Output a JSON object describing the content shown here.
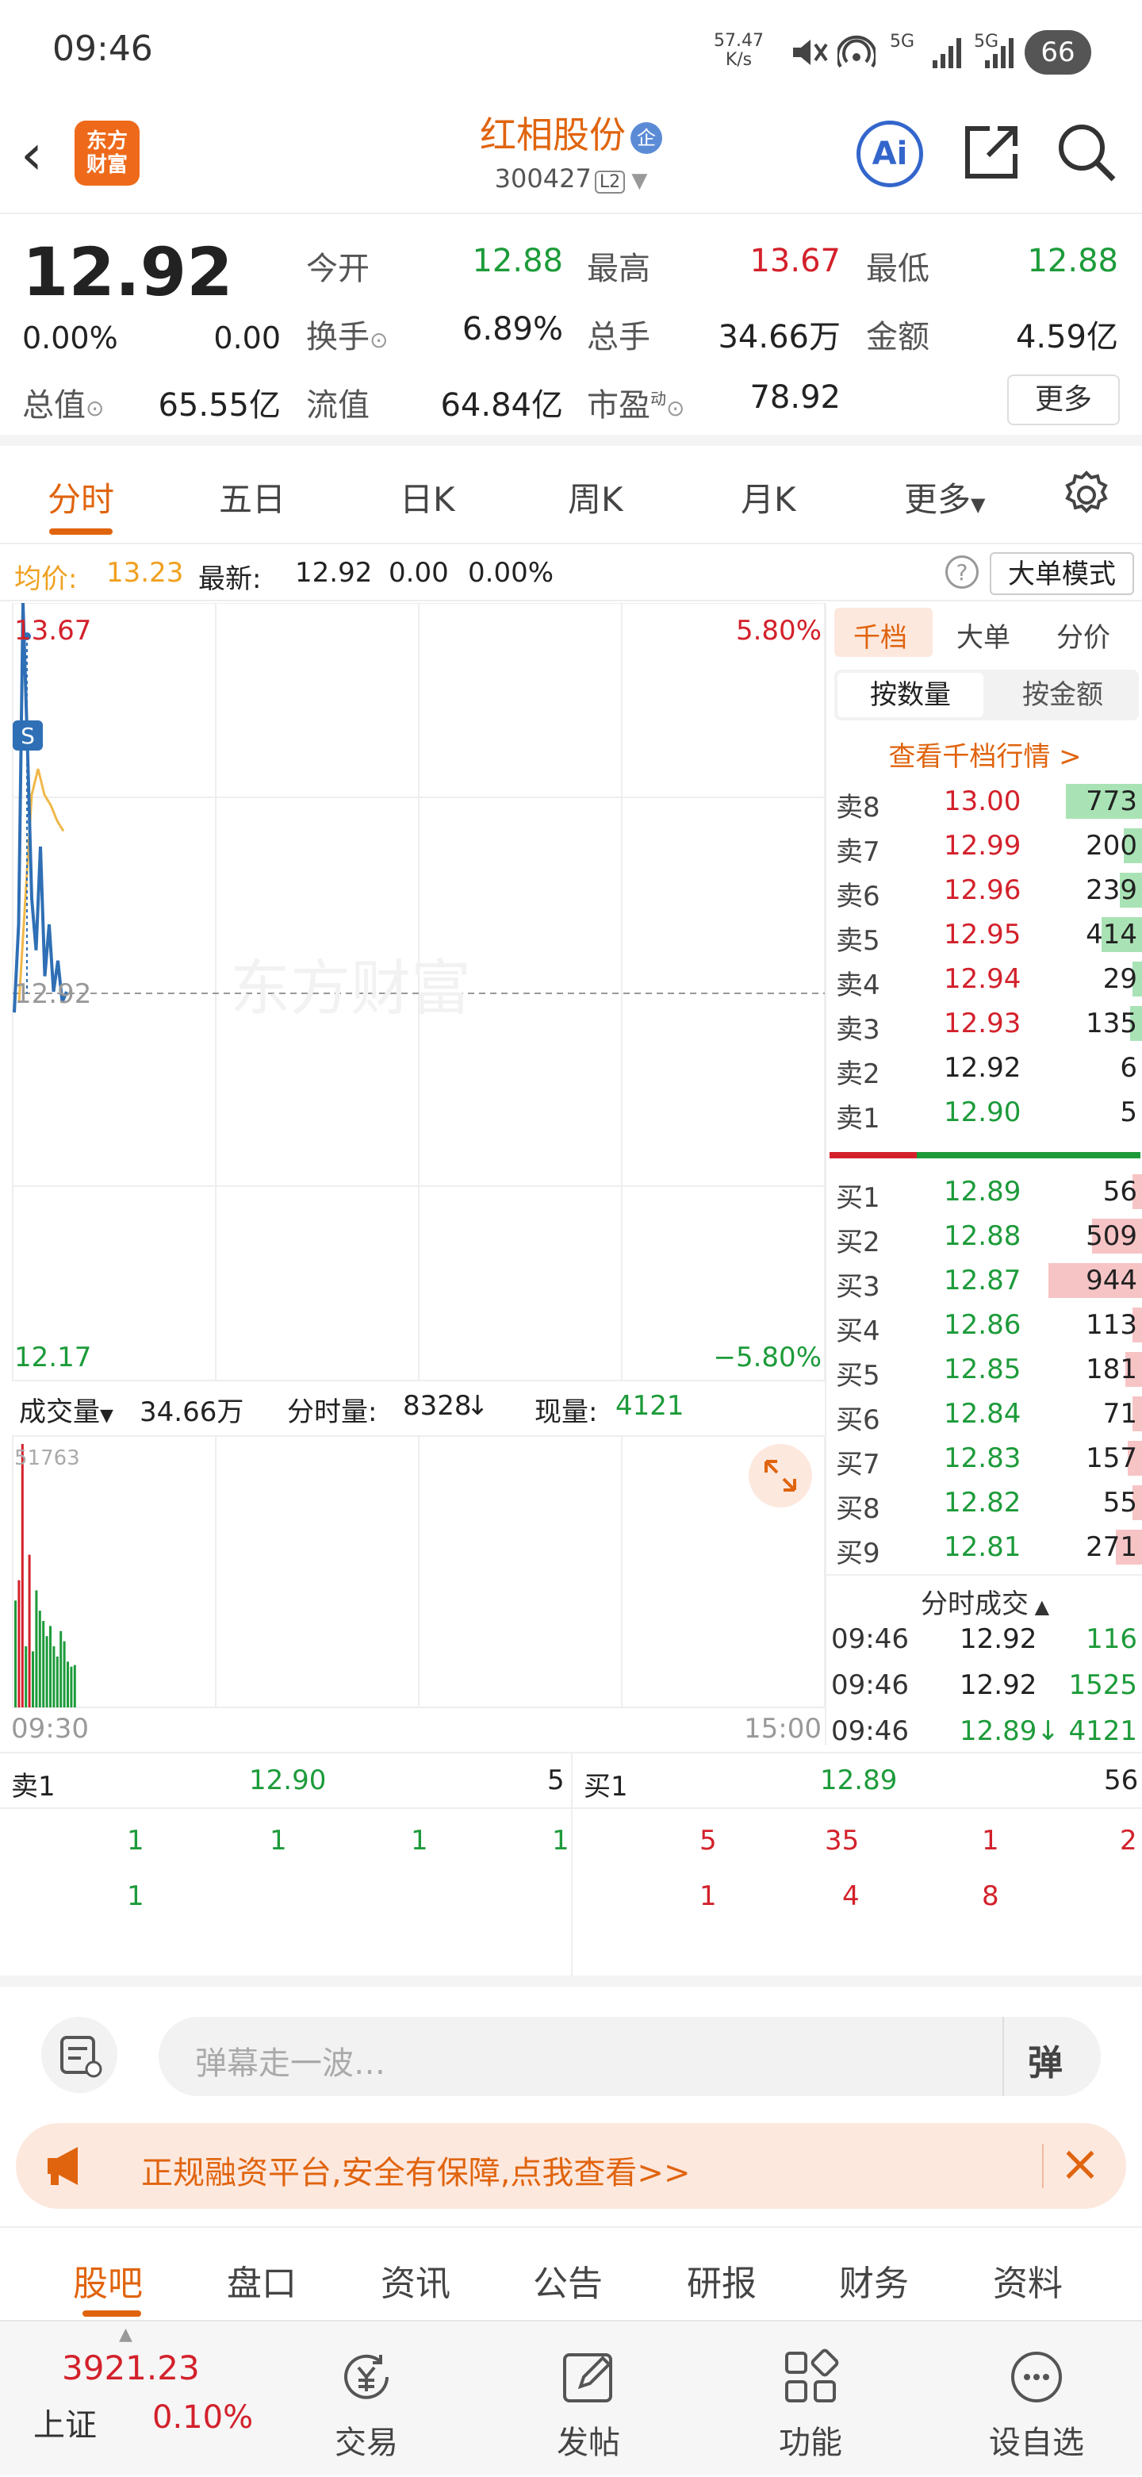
{
  "status": {
    "time": "09:46",
    "speed_top": "57.47",
    "speed_bottom": "K/s",
    "net1": "5G",
    "net2": "5G",
    "battery": "66"
  },
  "nav": {
    "logo_line1": "东方",
    "logo_line2": "财富",
    "title": "红相股份",
    "title_badge": "企",
    "code": "300427",
    "level": "L2",
    "ai_label": "Ai"
  },
  "quote": {
    "price": "12.92",
    "change_pct": "0.00%",
    "change": "0.00",
    "open_label": "今开",
    "open": "12.88",
    "high_label": "最高",
    "high": "13.67",
    "low_label": "最低",
    "low": "12.88",
    "turnover_label": "换手",
    "turnover": "6.89%",
    "volume_label": "总手",
    "volume": "34.66万",
    "amount_label": "金额",
    "amount": "4.59亿",
    "mcap_label": "总值",
    "mcap": "65.55亿",
    "float_label": "流值",
    "float": "64.84亿",
    "pe_label": "市盈",
    "pe_sup": "动",
    "pe": "78.92",
    "more": "更多"
  },
  "tabs": [
    "分时",
    "五日",
    "日K",
    "周K",
    "月K",
    "更多"
  ],
  "avgbar": {
    "avg_label": "均价:",
    "avg": "13.23",
    "latest_label": "最新:",
    "latest": "12.92",
    "chg": "0.00",
    "pct": "0.00%",
    "big_mode": "大单模式"
  },
  "chart": {
    "top_price": "13.67",
    "top_pct": "5.80%",
    "bottom_price": "12.17",
    "bottom_pct": "−5.80%",
    "prev_close": "12.92",
    "watermark": "东方财富",
    "s_marker": "S",
    "vol_label": "成交量",
    "vol_value": "34.66万",
    "minute_vol_label": "分时量:",
    "minute_vol": "8328",
    "now_vol_label": "现量:",
    "now_vol": "4121",
    "vol_max": "51763",
    "time_start": "09:30",
    "time_end": "15:00"
  },
  "chart_data": {
    "type": "line",
    "title": "",
    "xlabel": "",
    "ylabel": "",
    "ylim": [
      12.17,
      13.67
    ],
    "prev_close": 12.92,
    "series": [
      {
        "name": "",
        "values": [
          12.88,
          13.05,
          13.67,
          13.4,
          13.1,
          13.0,
          13.2,
          12.95,
          13.05,
          12.92,
          12.98,
          12.9,
          12.92
        ]
      },
      {
        "name": "",
        "values": [
          12.9,
          13.1,
          13.3,
          13.35,
          13.3,
          13.28,
          13.25,
          13.23
        ]
      }
    ],
    "volume": [
      52,
      58,
      51763,
      30,
      45,
      28,
      36,
      40,
      25,
      20,
      22,
      18,
      16,
      24,
      20,
      14,
      12,
      10
    ],
    "volume_scale": [
      21000,
      25000,
      51763,
      12000,
      30000,
      11000,
      23000,
      19000,
      17000,
      14000,
      16000,
      12000,
      10000,
      15000,
      13000,
      9000,
      8000,
      8328
    ]
  },
  "book": {
    "tab1": "千档",
    "tab2": "大单",
    "tab3": "分价",
    "sub1": "按数量",
    "sub2": "按金额",
    "view_link": "查看千档行情 >",
    "asks": [
      {
        "label": "卖8",
        "price": "13.00",
        "vol": "773",
        "ratio": 0.82
      },
      {
        "label": "卖7",
        "price": "12.99",
        "vol": "200",
        "ratio": 0.21
      },
      {
        "label": "卖6",
        "price": "12.96",
        "vol": "239",
        "ratio": 0.25
      },
      {
        "label": "卖5",
        "price": "12.95",
        "vol": "414",
        "ratio": 0.44
      },
      {
        "label": "卖4",
        "price": "12.94",
        "vol": "29",
        "ratio": 0.03
      },
      {
        "label": "卖3",
        "price": "12.93",
        "vol": "135",
        "ratio": 0.14
      },
      {
        "label": "卖2",
        "price": "12.92",
        "vol": "6",
        "ratio": 0.0
      },
      {
        "label": "卖1",
        "price": "12.90",
        "vol": "5",
        "ratio": 0.0
      }
    ],
    "bids": [
      {
        "label": "买1",
        "price": "12.89",
        "vol": "56",
        "ratio": 0.06
      },
      {
        "label": "买2",
        "price": "12.88",
        "vol": "509",
        "ratio": 0.54
      },
      {
        "label": "买3",
        "price": "12.87",
        "vol": "944",
        "ratio": 1.0
      },
      {
        "label": "买4",
        "price": "12.86",
        "vol": "113",
        "ratio": 0.12
      },
      {
        "label": "买5",
        "price": "12.85",
        "vol": "181",
        "ratio": 0.19
      },
      {
        "label": "买6",
        "price": "12.84",
        "vol": "71",
        "ratio": 0.08
      },
      {
        "label": "买7",
        "price": "12.83",
        "vol": "157",
        "ratio": 0.17
      },
      {
        "label": "买8",
        "price": "12.82",
        "vol": "55",
        "ratio": 0.06
      },
      {
        "label": "买9",
        "price": "12.81",
        "vol": "271",
        "ratio": 0.29
      }
    ],
    "trades_title": "分时成交",
    "trades": [
      {
        "time": "09:46",
        "price": "12.92",
        "vol": "116"
      },
      {
        "time": "09:46",
        "price": "12.92",
        "vol": "1525"
      },
      {
        "time": "09:46",
        "price": "12.89↓",
        "vol": "4121"
      }
    ]
  },
  "detail": {
    "ask_label": "卖1",
    "ask_price": "12.90",
    "ask_vol": "5",
    "bid_label": "买1",
    "bid_price": "12.89",
    "bid_vol": "56",
    "ask_row1": [
      "1",
      "1",
      "1",
      "1"
    ],
    "ask_row2": [
      "1"
    ],
    "bid_row1": [
      "5",
      "35",
      "1",
      "2"
    ],
    "bid_row2": [
      "1",
      "4",
      "8"
    ]
  },
  "danmu": {
    "placeholder": "弹幕走一波…",
    "btn": "弹"
  },
  "banner": {
    "text": "正规融资平台,安全有保障,点我查看>>"
  },
  "btabs": [
    "股吧",
    "盘口",
    "资讯",
    "公告",
    "研报",
    "财务",
    "资料"
  ],
  "bottom": {
    "index_value": "3921.23",
    "index_name": "上证",
    "index_pct": "0.10%",
    "trade": "交易",
    "post": "发帖",
    "func": "功能",
    "watch": "设自选"
  },
  "colors": {
    "accent": "#e0640e",
    "up": "#d3212b",
    "down": "#1d9b3a",
    "price_line": "#2f6fb5",
    "avg_line": "#f0b84a"
  }
}
